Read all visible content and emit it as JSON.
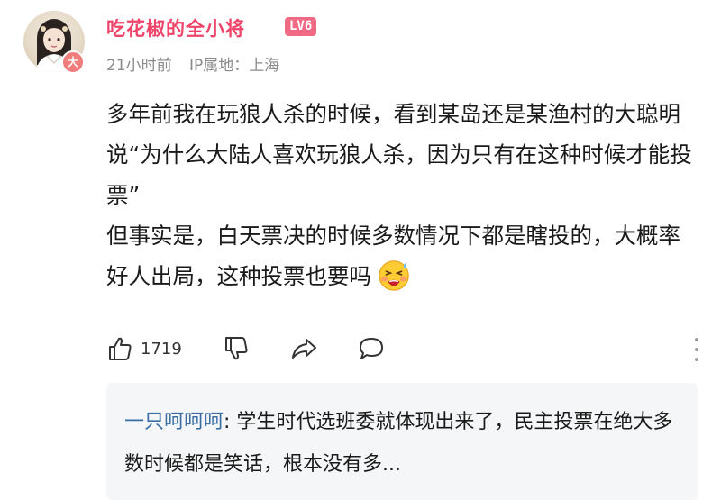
{
  "user": {
    "name": "吃花椒的全小将",
    "level": "LV6",
    "avatar_badge": "大",
    "time": "21小时前",
    "ip": "IP属地：上海"
  },
  "comment": {
    "paragraph1": "多年前我在玩狼人杀的时候，看到某岛还是某渔村的大聪明说“为什么大陆人喜欢玩狼人杀，因为只有在这种时候才能投票”",
    "paragraph2": "但事实是，白天票决的时候多数情况下都是瞎投的，大概率好人出局，这种投票也要吗",
    "emoji": "awkward-sweat-face-emoji"
  },
  "actions": {
    "like_count": "1719",
    "icons": [
      "thumbs-up-icon",
      "thumbs-down-icon",
      "share-icon",
      "comment-icon",
      "more-icon"
    ]
  },
  "reply": {
    "author": "一只呵呵呵",
    "separator": ": ",
    "text": "学生时代选班委就体现出来了，民主投票在绝大多数时候都是笑话，根本没有多..."
  },
  "colors": {
    "username": "#f0456b",
    "level_badge": "#f06a84",
    "reply_author": "#3a6ea5",
    "reply_bg": "#f5f6f7",
    "meta": "#8a8a8a"
  }
}
